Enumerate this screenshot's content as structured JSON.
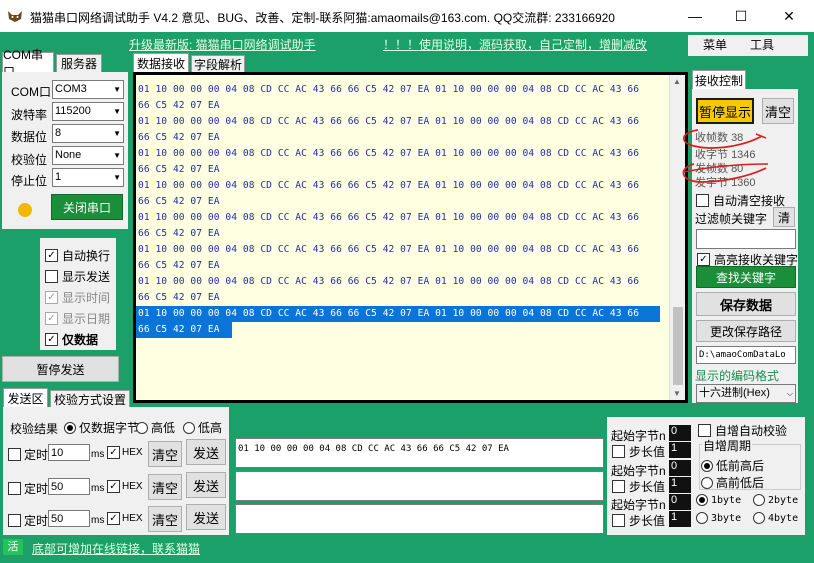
{
  "window": {
    "title": "猫猫串口网络调试助手 V4.2 意见、BUG、改善、定制-联系阿猫:amaomails@163.com. QQ交流群: 233166920",
    "min": "—",
    "max": "☐",
    "close": "✕"
  },
  "topbar": {
    "upgrade_link": "升级最新版: 猫猫串口网络调试助手",
    "help_link": "！！！使用说明，源码获取，自己定制，增删减改",
    "menu": "菜单",
    "tools": "工具"
  },
  "left_tabs": {
    "serial": "COM串口",
    "server": "服务器"
  },
  "serial": {
    "fields": [
      {
        "label": "COM口",
        "value": "COM3"
      },
      {
        "label": "波特率",
        "value": "115200"
      },
      {
        "label": "数据位",
        "value": "8"
      },
      {
        "label": "校验位",
        "value": "None"
      },
      {
        "label": "停止位",
        "value": "1"
      }
    ],
    "close_port": "关闭串口",
    "status_color": "#f5b800"
  },
  "display_options": [
    {
      "label": "自动换行",
      "checked": true
    },
    {
      "label": "显示发送",
      "checked": false
    },
    {
      "label": "显示时间",
      "checked": true
    },
    {
      "label": "显示日期",
      "checked": true
    },
    {
      "label": "仅数据",
      "checked": true
    }
  ],
  "pause_send": "暂停发送",
  "recv_tabs": {
    "data": "数据接收",
    "fields": "字段解析"
  },
  "recv_lines": [
    "01 10 00 00 00 04 08 CD CC AC 43 66 66 C5 42 07 EA 01 10 00 00 00 04 08 CD CC AC 43 66",
    "66 C5 42 07 EA",
    "01 10 00 00 00 04 08 CD CC AC 43 66 66 C5 42 07 EA 01 10 00 00 00 04 08 CD CC AC 43 66",
    "66 C5 42 07 EA",
    "01 10 00 00 00 04 08 CD CC AC 43 66 66 C5 42 07 EA 01 10 00 00 00 04 08 CD CC AC 43 66",
    "66 C5 42 07 EA",
    "01 10 00 00 00 04 08 CD CC AC 43 66 66 C5 42 07 EA 01 10 00 00 00 04 08 CD CC AC 43 66",
    "66 C5 42 07 EA",
    "01 10 00 00 00 04 08 CD CC AC 43 66 66 C5 42 07 EA 01 10 00 00 00 04 08 CD CC AC 43 66",
    "66 C5 42 07 EA",
    "01 10 00 00 00 04 08 CD CC AC 43 66 66 C5 42 07 EA 01 10 00 00 00 04 08 CD CC AC 43 66",
    "66 C5 42 07 EA",
    "01 10 00 00 00 04 08 CD CC AC 43 66 66 C5 42 07 EA 01 10 00 00 00 04 08 CD CC AC 43 66",
    "66 C5 42 07 EA",
    "01 10 00 00 00 04 08 CD CC AC 43 66 66 C5 42 07 EA 01 10 00 00 00 04 08 CD CC AC 43 66",
    "66 C5 42 07 EA"
  ],
  "recv_control": {
    "title": "接收控制",
    "pause_display": "暂停显示",
    "clear": "清空",
    "recv_frames_label": "收帧数",
    "recv_frames": "38",
    "recv_bytes_label": "收字节",
    "recv_bytes": "1346",
    "send_frames_label": "发帧数",
    "send_frames": "80",
    "send_bytes_label": "发字节",
    "send_bytes": "1360",
    "auto_clear": "自动清空接收",
    "filter_label": "过滤帧关键字",
    "filter_clear": "清",
    "highlight": "高亮接收关键字",
    "find_keyword": "查找关键字",
    "save_data": "保存数据",
    "change_path": "更改保存路径",
    "path": "D:\\amaoComDataLo",
    "encoding_label": "显示的编码格式",
    "encoding_value": "十六进制(Hex)"
  },
  "send_tabs": {
    "send": "发送区",
    "check": "校验方式设置"
  },
  "send": {
    "check_result": "校验结果",
    "only_data": "仅数据字节",
    "high": "高低",
    "low": "低高",
    "rows": [
      {
        "timer_label": "定时",
        "interval": "10",
        "unit": "ms",
        "hex": "HEX",
        "clear": "清空",
        "send": "发送",
        "content": "01 10 00 00 00 04 08 CD CC AC 43 66 66 C5 42 07 EA"
      },
      {
        "timer_label": "定时",
        "interval": "50",
        "unit": "ms",
        "hex": "HEX",
        "clear": "清空",
        "send": "发送",
        "content": ""
      },
      {
        "timer_label": "定时",
        "interval": "50",
        "unit": "ms",
        "hex": "HEX",
        "clear": "清空",
        "send": "发送",
        "content": ""
      }
    ]
  },
  "checksum": {
    "groups": [
      {
        "start_label": "起始字节n",
        "start": "0",
        "step_label": "步长值",
        "step": "1"
      },
      {
        "start_label": "起始字节n",
        "start": "0",
        "step_label": "步长值",
        "step": "1"
      },
      {
        "start_label": "起始字节n",
        "start": "0",
        "step_label": "步长值",
        "step": "1"
      }
    ],
    "auto_check": "自增自动校验",
    "period_title": "自增周期",
    "low_first": "低前高后",
    "high_first": "高前低后",
    "byte1": "1byte",
    "byte2": "2byte",
    "byte3": "3byte",
    "byte4": "4byte"
  },
  "status": {
    "badge": "活",
    "link": "底部可增加在线链接，联系猫猫"
  }
}
